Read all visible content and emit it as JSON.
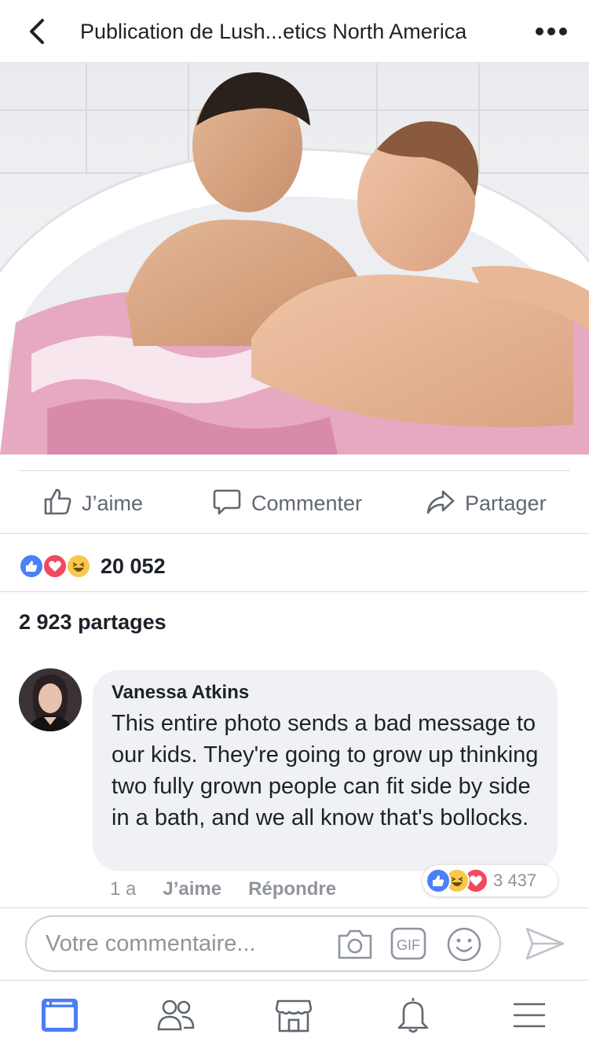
{
  "header": {
    "title": "Publication de Lush...etics North America"
  },
  "actions": {
    "like": "J’aime",
    "comment": "Commenter",
    "share": "Partager"
  },
  "reactions": {
    "count": "20 052"
  },
  "shares": {
    "text": "2 923 partages"
  },
  "comment": {
    "author": "Vanessa Atkins",
    "text": "This entire photo sends a bad message to our kids. They're going to grow up thinking two fully grown people can fit side by side in a bath, and we all know that's bollocks.",
    "time": "1 a",
    "like": "J’aime",
    "reply": "Répondre",
    "reaction_count": "3 437"
  },
  "composer": {
    "placeholder": "Votre commentaire...",
    "gif_label": "GIF"
  },
  "icons": [
    "back-icon",
    "more-icon",
    "thumbs-up-icon",
    "speech-bubble-icon",
    "share-arrow-icon",
    "camera-icon",
    "gif-icon",
    "emoji-icon",
    "send-icon",
    "news-feed-icon",
    "friends-icon",
    "marketplace-icon",
    "bell-icon",
    "menu-icon"
  ],
  "colors": {
    "accent": "#4a7ef6",
    "like": "#4b80f7",
    "love": "#ef4a5f",
    "haha": "#f7c94b",
    "muted": "#606770"
  }
}
